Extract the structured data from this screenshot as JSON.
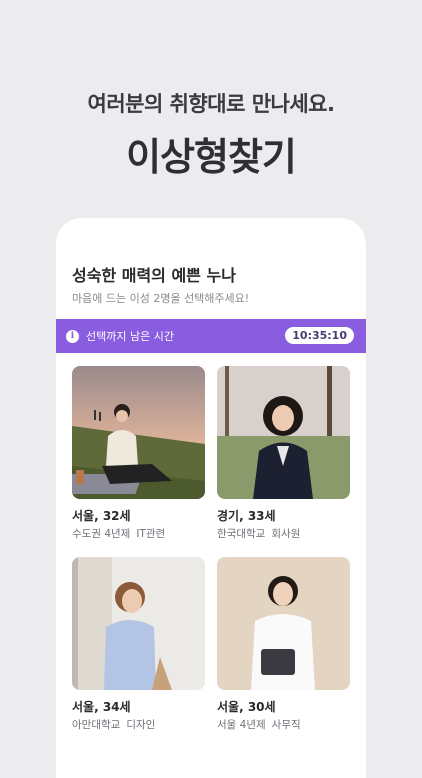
{
  "hero": {
    "headline": "여러분의 취향대로 만나세요.",
    "title": "이상형찾기"
  },
  "section": {
    "title": "성숙한 매력의 예쁜 누나",
    "subtitle": "마음에 드는 이성 2명을 선택해주세요!"
  },
  "timer": {
    "label": "선택까지 남은 시간",
    "value": "10:35:10"
  },
  "profiles": [
    {
      "name_age": "서울, 32세",
      "detail1": "수도권 4년제",
      "detail2": "IT관련"
    },
    {
      "name_age": "경기, 33세",
      "detail1": "한국대학교",
      "detail2": "회사원"
    },
    {
      "name_age": "서울, 34세",
      "detail1": "아만대학교",
      "detail2": "디자인"
    },
    {
      "name_age": "서울, 30세",
      "detail1": "서울 4년제",
      "detail2": "사무직"
    }
  ],
  "colors": {
    "accent": "#8a5ce0",
    "background": "#ececee"
  }
}
